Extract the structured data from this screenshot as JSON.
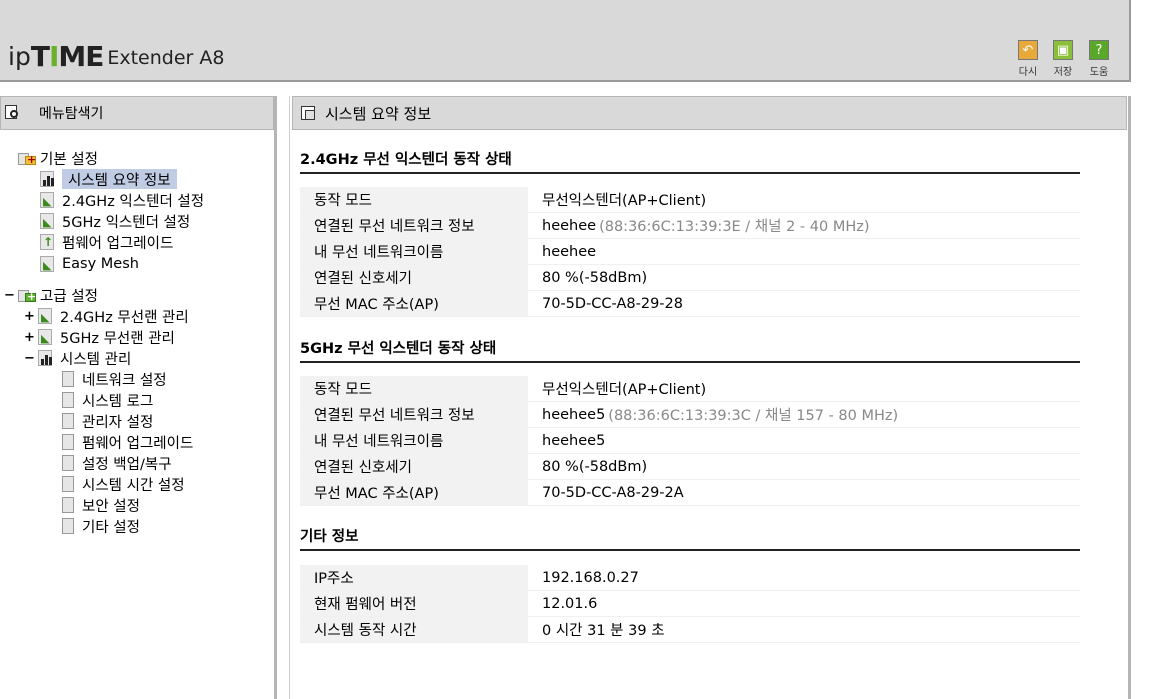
{
  "header": {
    "logo_ip": "ip",
    "logo_time_1": "T",
    "logo_time_i": "I",
    "logo_time_2": "ME",
    "model": "Extender A8",
    "buttons": [
      {
        "label": "다시",
        "icon": "undo-icon",
        "color": "#e8a93a",
        "glyph": "↶"
      },
      {
        "label": "저장",
        "icon": "save-icon",
        "color": "#8bbf3a",
        "glyph": "▣"
      },
      {
        "label": "도움",
        "icon": "help-icon",
        "color": "#5aa82a",
        "glyph": "?"
      }
    ]
  },
  "menu": {
    "title": "메뉴탐색기",
    "basic": {
      "label": "기본 설정",
      "items": [
        "시스템 요약 정보",
        "2.4GHz 익스텐더 설정",
        "5GHz 익스텐더 설정",
        "펌웨어 업그레이드",
        "Easy Mesh"
      ]
    },
    "advanced": {
      "expander": "−",
      "label": "고급 설정",
      "wl24": {
        "expander": "+",
        "label": "2.4GHz 무선랜 관리"
      },
      "wl5": {
        "expander": "+",
        "label": "5GHz 무선랜 관리"
      },
      "system": {
        "expander": "−",
        "label": "시스템 관리",
        "items": [
          "네트워크 설정",
          "시스템 로그",
          "관리자 설정",
          "펌웨어 업그레이드",
          "설정 백업/복구",
          "시스템 시간 설정",
          "보안 설정",
          "기타 설정"
        ]
      }
    }
  },
  "content": {
    "title": "시스템 요약 정보",
    "sections": [
      {
        "title": "2.4GHz 무선 익스텐더 동작 상태",
        "rows": [
          {
            "k": "동작 모드",
            "v": "무선익스텐더(AP+Client)",
            "sub": ""
          },
          {
            "k": "연결된 무선 네트워크 정보",
            "v": "heehee",
            "sub": "(88:36:6C:13:39:3E / 채널 2 - 40 MHz)"
          },
          {
            "k": "내 무선 네트워크이름",
            "v": "heehee",
            "sub": ""
          },
          {
            "k": "연결된 신호세기",
            "v": "80 %(-58dBm)",
            "sub": ""
          },
          {
            "k": "무선 MAC 주소(AP)",
            "v": "70-5D-CC-A8-29-28",
            "sub": ""
          }
        ]
      },
      {
        "title": "5GHz 무선 익스텐더 동작 상태",
        "rows": [
          {
            "k": "동작 모드",
            "v": "무선익스텐더(AP+Client)",
            "sub": ""
          },
          {
            "k": "연결된 무선 네트워크 정보",
            "v": "heehee5",
            "sub": "(88:36:6C:13:39:3C / 채널 157 - 80 MHz)"
          },
          {
            "k": "내 무선 네트워크이름",
            "v": "heehee5",
            "sub": ""
          },
          {
            "k": "연결된 신호세기",
            "v": "80 %(-58dBm)",
            "sub": ""
          },
          {
            "k": "무선 MAC 주소(AP)",
            "v": "70-5D-CC-A8-29-2A",
            "sub": ""
          }
        ]
      },
      {
        "title": "기타 정보",
        "rows": [
          {
            "k": "IP주소",
            "v": "192.168.0.27",
            "sub": ""
          },
          {
            "k": "현재 펌웨어 버전",
            "v": "12.01.6",
            "sub": ""
          },
          {
            "k": "시스템 동작 시간",
            "v": "0 시간 31 분 39 초",
            "sub": ""
          }
        ]
      }
    ]
  }
}
